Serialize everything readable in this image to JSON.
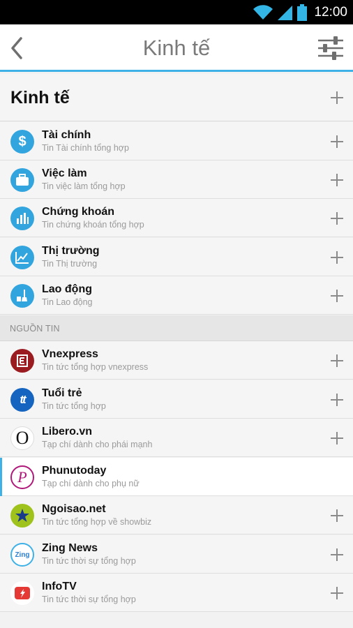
{
  "status_bar": {
    "time": "12:00",
    "icons": [
      "wifi-icon",
      "signal-icon",
      "battery-icon"
    ]
  },
  "app_bar": {
    "title": "Kinh tế",
    "back_icon": "chevron-left-icon",
    "filter_icon": "sliders-icon",
    "accent_color": "#3eb1e6"
  },
  "section": {
    "title": "Kinh tế"
  },
  "categories": [
    {
      "title": "Tài chính",
      "subtitle": "Tin Tài chính tổng hợp",
      "icon": "dollar-icon"
    },
    {
      "title": "Việc làm",
      "subtitle": "Tin việc làm tổng hợp",
      "icon": "briefcase-icon"
    },
    {
      "title": "Chứng khoán",
      "subtitle": "Tin chứng khoán tổng hợp",
      "icon": "bar-chart-icon"
    },
    {
      "title": "Thị trường",
      "subtitle": "Tin Thị trường",
      "icon": "line-chart-icon"
    },
    {
      "title": "Lao động",
      "subtitle": "Tin Lao động",
      "icon": "broom-bucket-icon"
    }
  ],
  "sources_label": "NGUỒN TIN",
  "sources": [
    {
      "title": "Vnexpress",
      "subtitle": "Tin tức tổng hợp vnexpress",
      "icon": "vnexpress-logo-icon",
      "color": "#9b1c20"
    },
    {
      "title": "Tuổi trẻ",
      "subtitle": "Tin tức tổng hợp",
      "icon": "tuoitre-logo-icon",
      "color": "#1565c0"
    },
    {
      "title": "Libero.vn",
      "subtitle": "Tạp chí dành cho phái mạnh",
      "icon": "libero-logo-icon",
      "glyph": "O"
    },
    {
      "title": "Phunutoday",
      "subtitle": "Tạp chí dành cho phụ nữ",
      "icon": "phunutoday-logo-icon",
      "glyph": "P",
      "selected": true
    },
    {
      "title": "Ngoisao.net",
      "subtitle": "Tin tức tổng hợp về showbiz",
      "icon": "ngoisao-logo-icon",
      "color": "#9fc31c"
    },
    {
      "title": "Zing News",
      "subtitle": "Tin tức thời sự tổng hợp",
      "icon": "zing-logo-icon",
      "glyph": "Zing"
    },
    {
      "title": "InfoTV",
      "subtitle": "Tin tức thời sự tổng hợp",
      "icon": "infotv-logo-icon",
      "color": "#e53935"
    }
  ]
}
